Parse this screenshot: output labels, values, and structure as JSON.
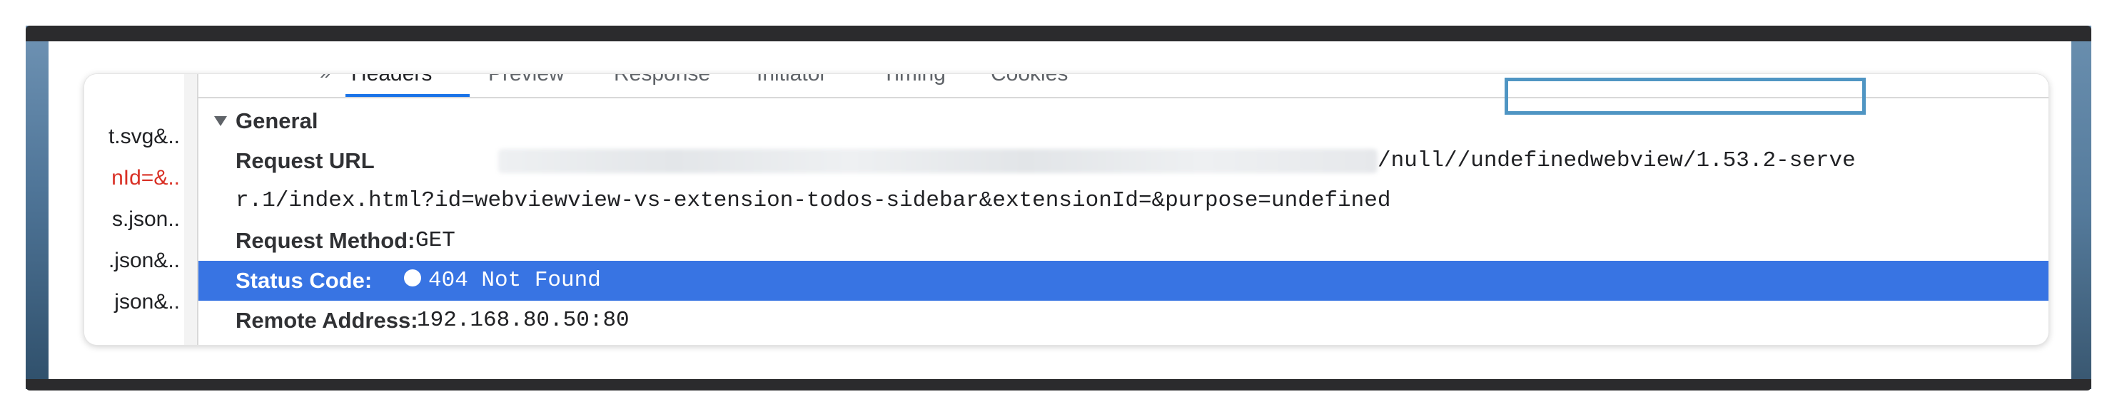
{
  "network": {
    "requests": [
      {
        "name": "t.svg&..",
        "error": false
      },
      {
        "name": "nId=&..",
        "error": true
      },
      {
        "name": "s.json..",
        "error": false
      },
      {
        "name": ".json&..",
        "error": false
      },
      {
        "name": "json&..",
        "error": false
      }
    ]
  },
  "tabs": {
    "overflow": "»",
    "items": [
      "Headers",
      "Preview",
      "Response",
      "Initiator",
      "Timing",
      "Cookies"
    ],
    "active": "Headers"
  },
  "general": {
    "title": "General",
    "request_url": {
      "label": "Request URL",
      "visible_part_line1": "/null//undefinedwebview/1.53.2-serve",
      "line2": "r.1/index.html?id=webviewview-vs-extension-todos-sidebar&extensionId=&purpose=undefined"
    },
    "request_method": {
      "label": "Request Method:",
      "value": "GET"
    },
    "status_code": {
      "label": "Status Code:",
      "value": "404 Not Found"
    },
    "remote_address": {
      "label": "Remote Address:",
      "value": "192.168.80.50:80"
    }
  },
  "colors": {
    "selected_row": "#3874e3",
    "highlight_box": "#4f95c3",
    "error_text": "#d93025"
  }
}
